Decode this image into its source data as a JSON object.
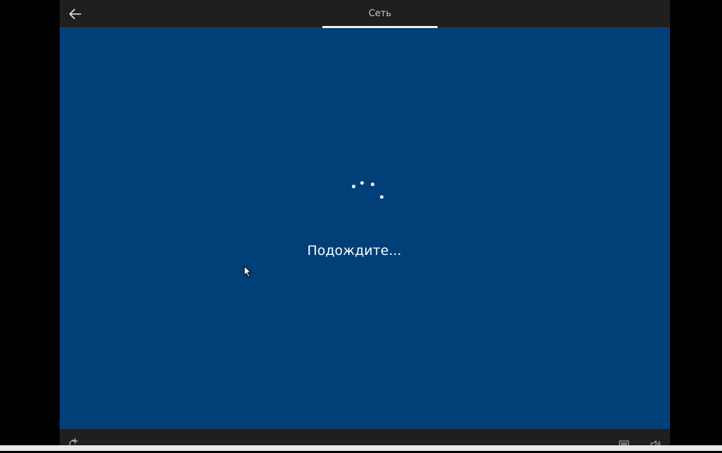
{
  "header": {
    "tab_label": "Сеть",
    "back_icon": "arrow-left-icon"
  },
  "main": {
    "status_text": "Подождите..."
  },
  "footer": {
    "accessibility_icon": "ease-of-access-icon",
    "keyboard_icon": "keyboard-icon",
    "volume_icon": "volume-icon"
  },
  "colors": {
    "background": "#003f78",
    "bars": "#1f1f1f",
    "letterbox": "#000000",
    "text": "#ffffff"
  }
}
